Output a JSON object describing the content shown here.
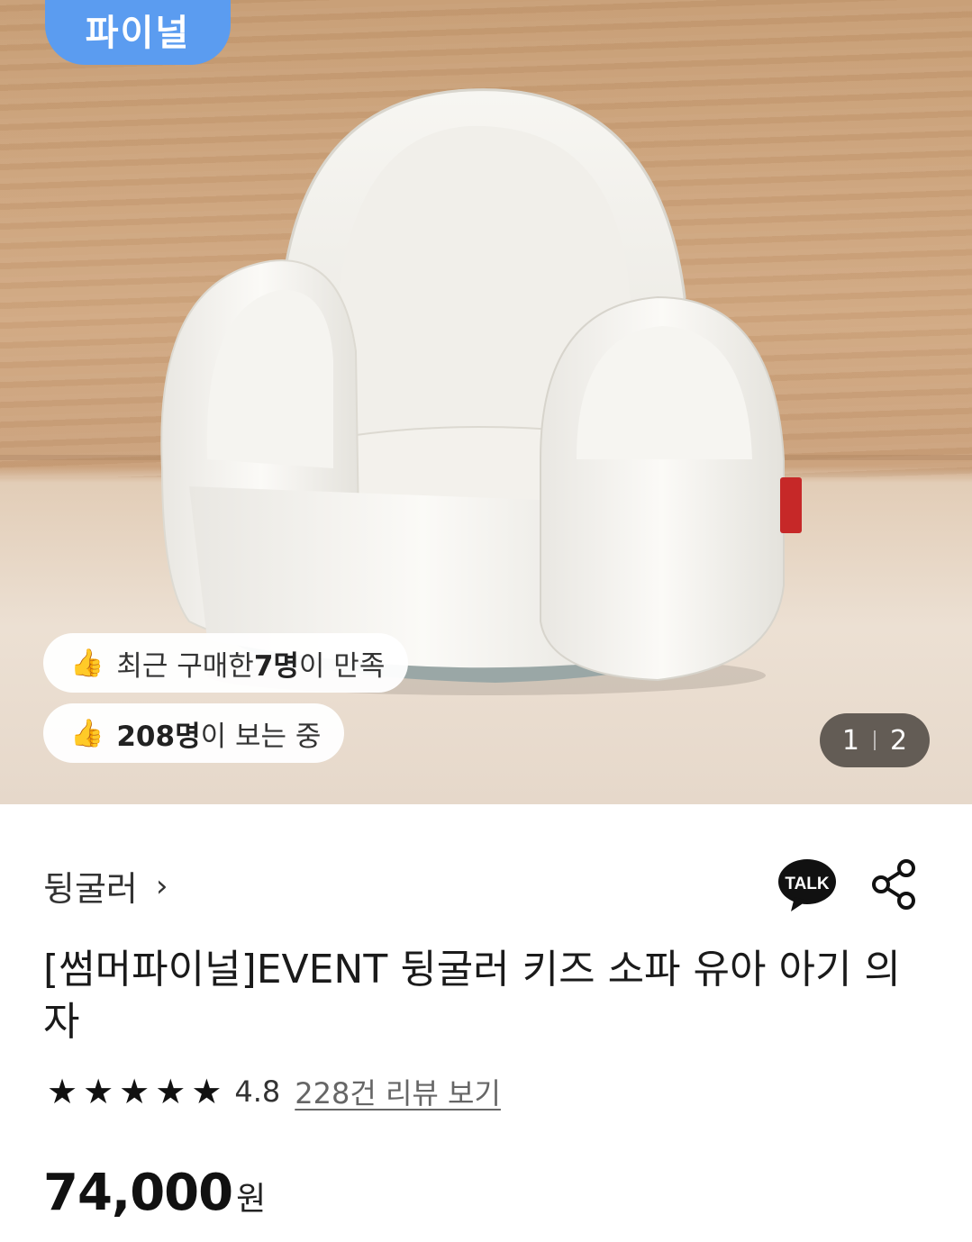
{
  "hero": {
    "promo_tag": "파이널",
    "badge_recent": {
      "prefix": "최근 구매한 ",
      "bold": "7명",
      "suffix": "이 만족"
    },
    "badge_viewing": {
      "bold": "208명",
      "suffix": "이 보는 중"
    },
    "image_counter": {
      "current": "1",
      "total": "2"
    }
  },
  "product": {
    "brand": "뒹굴러",
    "talk_label": "TALK",
    "title": "[썸머파이널]EVENT 뒹굴러 키즈 소파 유아 아기 의자",
    "rating": {
      "stars": 5,
      "value": "4.8",
      "review_link": "228건 리뷰 보기"
    },
    "price": {
      "amount": "74,000",
      "currency": "원"
    }
  }
}
